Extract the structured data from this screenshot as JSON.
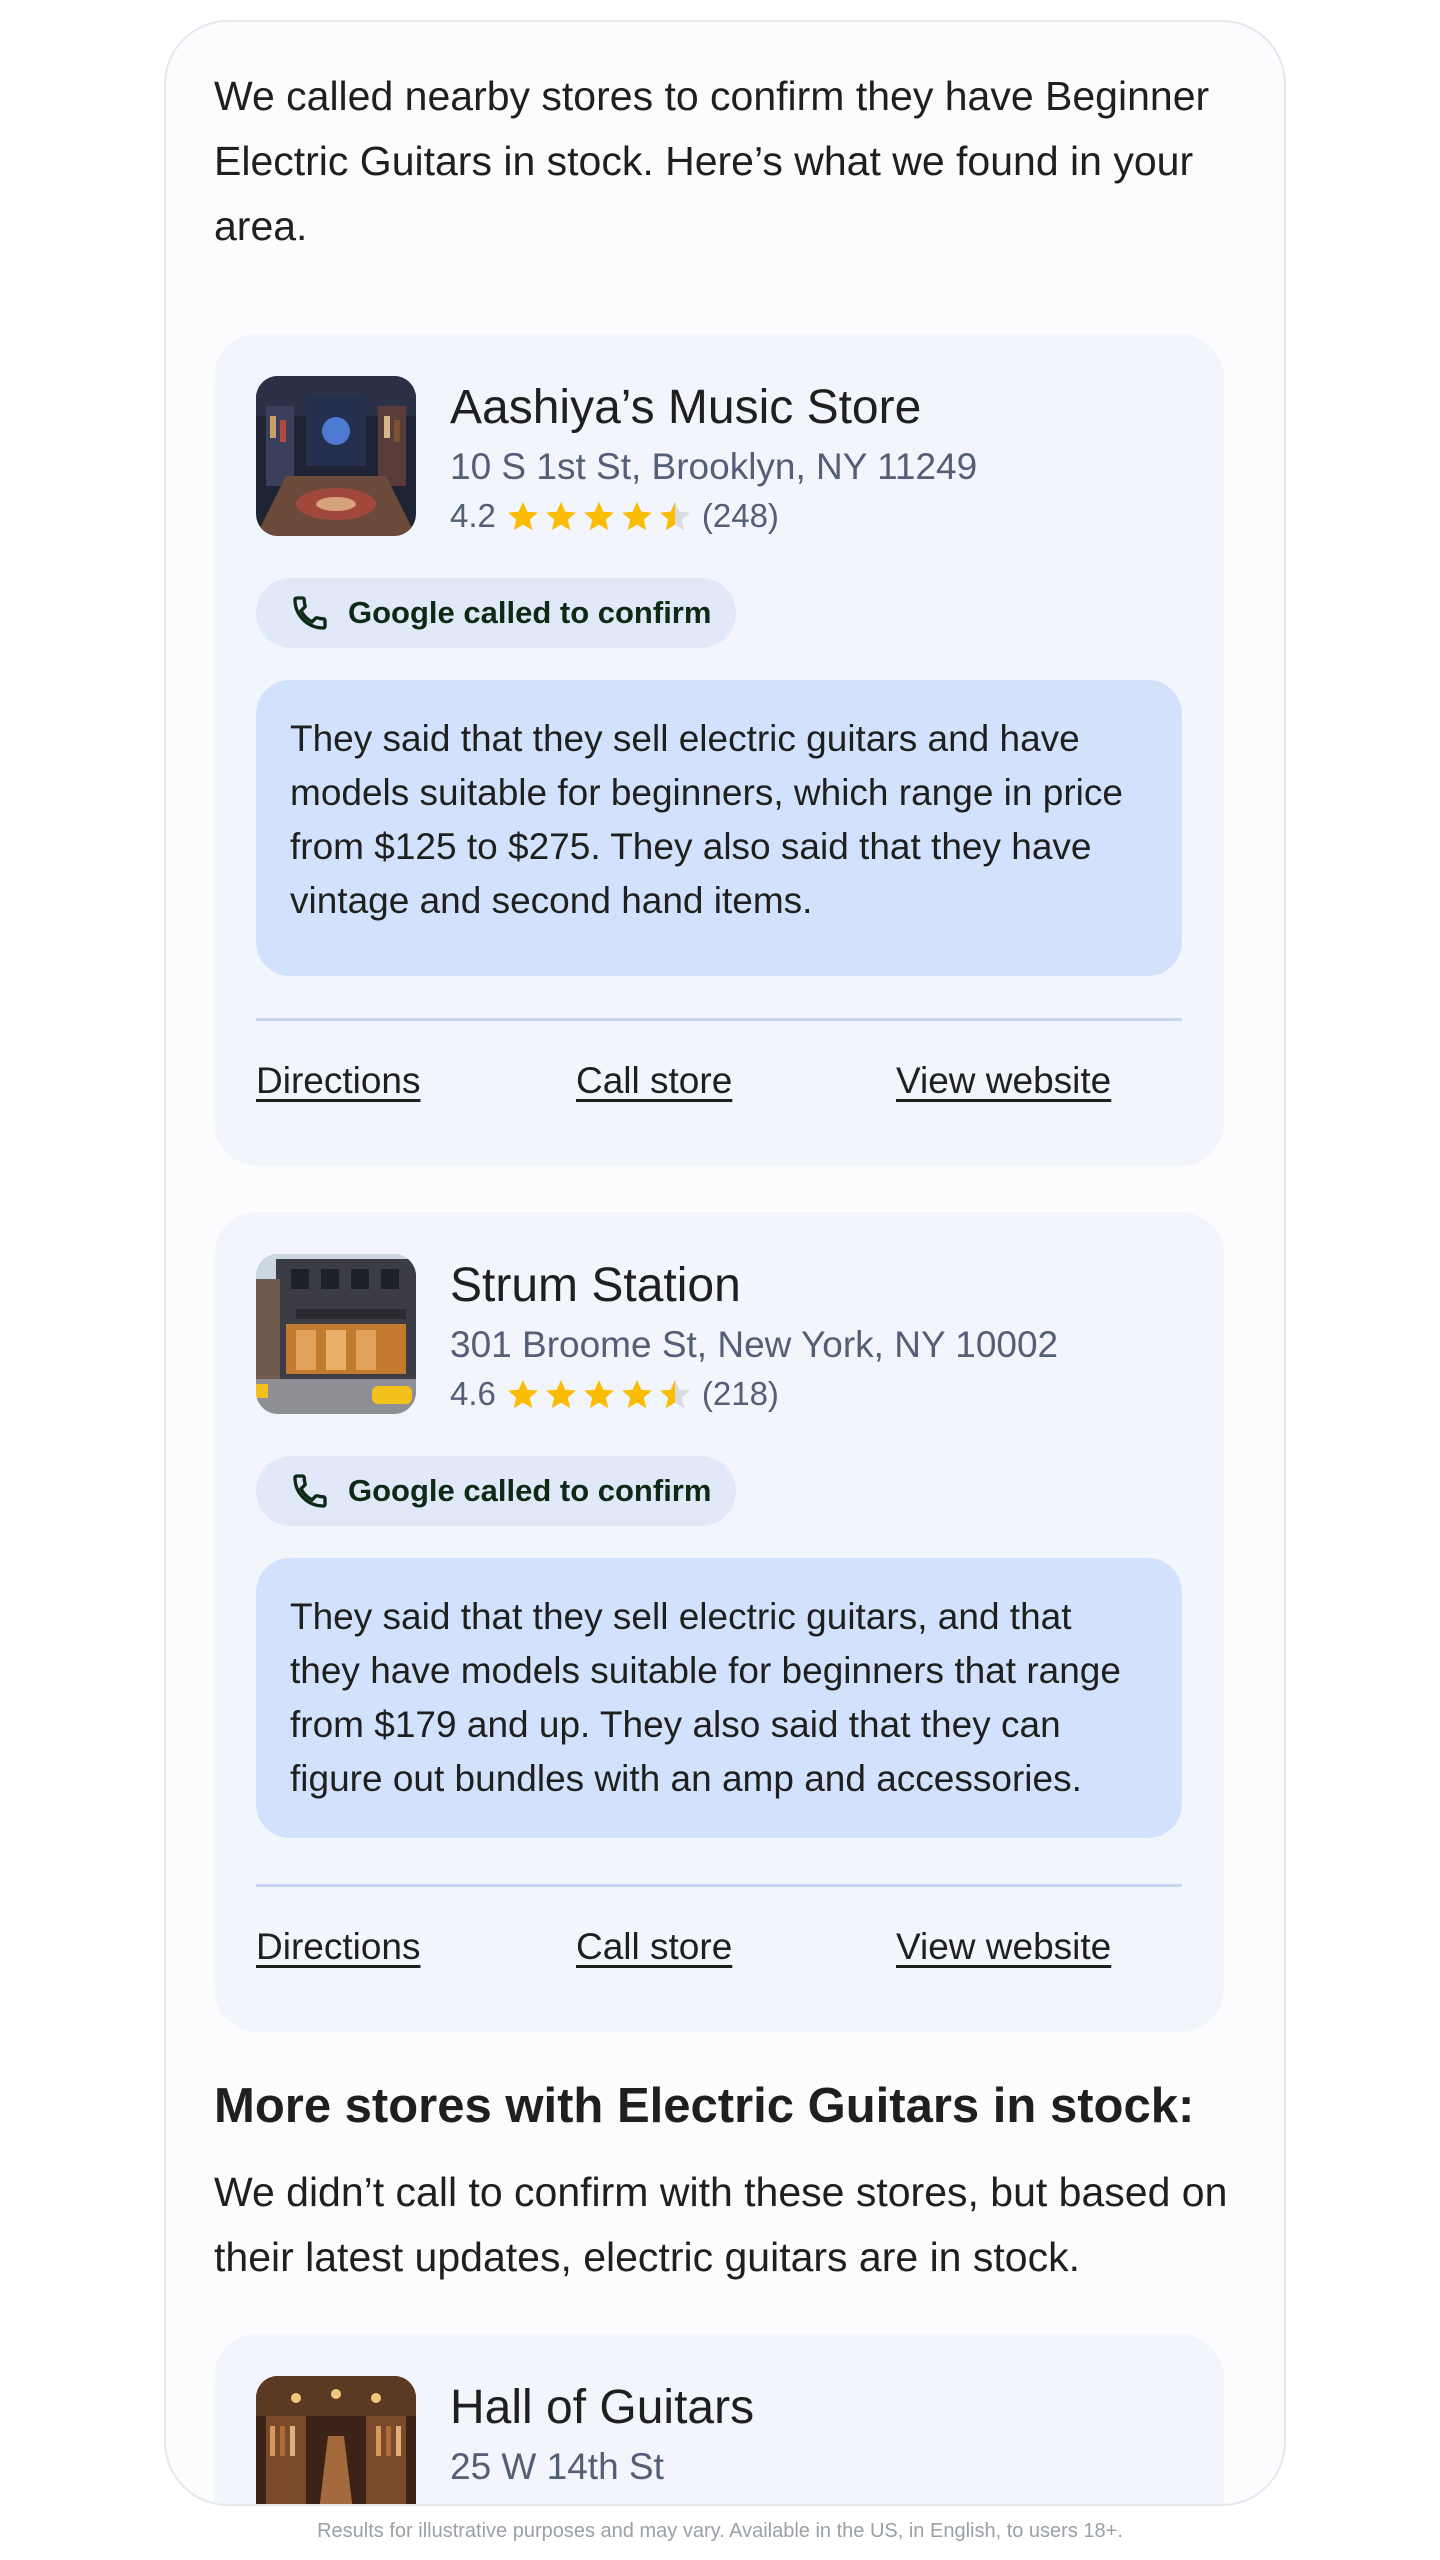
{
  "intro": "We called nearby stores to confirm they have Beginner Electric Guitars in stock. Here’s what we found in your area.",
  "stores": [
    {
      "name": "Aashiya’s Music Store",
      "address": "10 S 1st St, Brooklyn, NY 11249",
      "rating": "4.2",
      "reviews": "(248)",
      "chip": "Google called to confirm",
      "summary": "They said that they sell electric guitars and have models suitable for beginners, which range in price from $125 to $275. They also said that they have vintage and second hand items.",
      "actions": {
        "directions": "Directions",
        "call": "Call store",
        "website": "View website"
      }
    },
    {
      "name": "Strum Station",
      "address": "301 Broome St, New York, NY 10002",
      "rating": "4.6",
      "reviews": "(218)",
      "chip": "Google called to confirm",
      "summary": "They said that they sell electric guitars, and that they have models suitable for beginners that range from $179 and up. They also said that they can figure out bundles with an amp and accessories.",
      "actions": {
        "directions": "Directions",
        "call": "Call store",
        "website": "View website"
      }
    },
    {
      "name": "Hall of Guitars",
      "address": "25 W 14th St"
    }
  ],
  "more": {
    "title": "More stores with Electric Guitars in stock:",
    "description": "We didn’t call to confirm with these stores, but based on their latest updates, electric guitars are in stock."
  },
  "disclaimer": "Results for illustrative purposes and may vary. Available in the US, in English, to users 18+.",
  "colors": {
    "star": "#fbbc04",
    "star_empty": "#dadce0",
    "chip_bg": "#e1e8f8",
    "bubble_bg": "#d3e2fc",
    "card_bg": "#f2f5fc"
  },
  "icons": {
    "chip": "phone-icon",
    "rating": "star-icon"
  }
}
